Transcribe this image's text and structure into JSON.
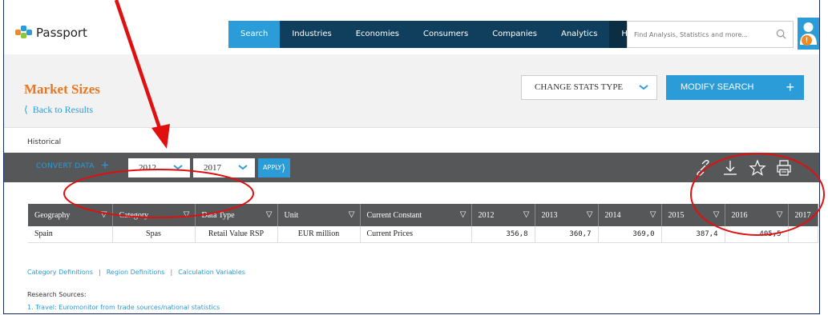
{
  "brand": {
    "name": "Passport"
  },
  "nav": {
    "items": [
      {
        "label": "Search",
        "state": "active"
      },
      {
        "label": "Industries",
        "state": ""
      },
      {
        "label": "Economies",
        "state": ""
      },
      {
        "label": "Consumers",
        "state": ""
      },
      {
        "label": "Companies",
        "state": ""
      },
      {
        "label": "Analytics",
        "state": ""
      },
      {
        "label": "Help",
        "state": "help"
      }
    ],
    "search_placeholder": "Find Analysis, Statistics and more..."
  },
  "header": {
    "title": "Market Sizes",
    "back_label": "Back to Results",
    "stats_type_label": "CHANGE STATS TYPE",
    "modify_search_label": "MODIFY SEARCH"
  },
  "section_label": "Historical",
  "toolbar": {
    "convert_label": "CONVERT DATA",
    "year_from": "2012",
    "year_to": "2017",
    "apply_label": "APPLY",
    "icons": [
      "link-icon",
      "download-icon",
      "star-icon",
      "print-icon"
    ]
  },
  "table": {
    "columns": [
      "Geography",
      "Category",
      "Data Type",
      "Unit",
      "Current Constant",
      "2012",
      "2013",
      "2014",
      "2015",
      "2016",
      "2017"
    ],
    "rows": [
      {
        "geography": "Spain",
        "category": "Spas",
        "data_type": "Retail Value RSP",
        "unit": "EUR million",
        "current_constant": "Current Prices",
        "v2012": "356,8",
        "v2013": "360,7",
        "v2014": "369,0",
        "v2015": "387,4",
        "v2016": "405,5",
        "v2017": ""
      }
    ]
  },
  "footer_links": [
    "Category Definitions",
    "Region Definitions",
    "Calculation Variables"
  ],
  "research": {
    "label": "Research Sources:",
    "sources": [
      "1. Travel: Euromonitor from trade sources/national statistics"
    ]
  },
  "colors": {
    "accent_blue": "#2b9cd8",
    "nav_dark": "#0f3f5c",
    "title_orange": "#e87722",
    "toolbar_gray": "#555759",
    "annotation_red": "#e01010"
  }
}
